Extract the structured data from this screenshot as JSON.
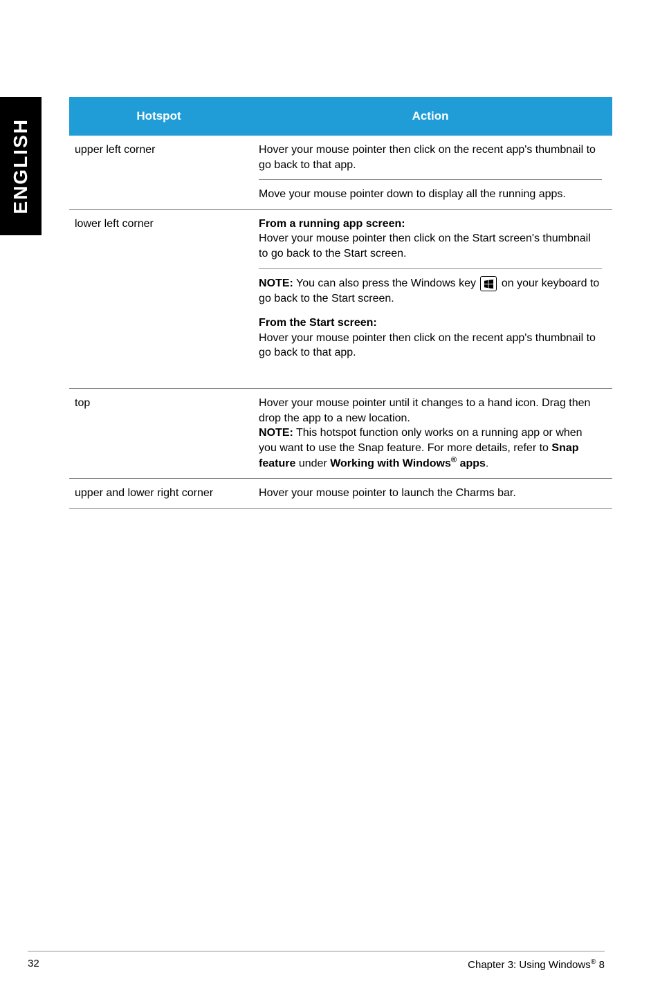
{
  "side_label": "ENGLISH",
  "table": {
    "headers": {
      "hotspot": "Hotspot",
      "action": "Action"
    },
    "rows": {
      "upper_left": {
        "label": "upper left corner",
        "action1": "Hover your mouse pointer then click on the recent app's thumbnail to go back to that app.",
        "action2": "Move your mouse pointer down to display all the running apps."
      },
      "lower_left": {
        "label": "lower left corner",
        "heading1": "From a running app screen:",
        "text1": "Hover your mouse pointer then click on the Start screen's thumbnail to go back to the Start screen.",
        "note_label": "NOTE:",
        "note_pre": "  You can also press the Windows key ",
        "note_post": " on your keyboard to go back to the Start screen.",
        "heading2": "From the Start screen:",
        "text2": "Hover your mouse pointer then click on the recent app's thumbnail to go back to that app."
      },
      "top": {
        "label": "top",
        "text1": "Hover your mouse pointer until it changes to a hand icon. Drag then drop the app to a new location.",
        "note_label": "NOTE:",
        "note_text": "  This hotspot function only works on a running app or when you want to use the Snap feature. For more details, refer to ",
        "bold1": "Snap feature",
        "mid": " under ",
        "bold2": "Working with Windows",
        "sup": "®",
        "bold3": " apps",
        "end": "."
      },
      "upper_lower_right": {
        "label": "upper and lower right corner",
        "action": "Hover your mouse pointer to launch the Charms bar."
      }
    }
  },
  "footer": {
    "page": "32",
    "chapter": "Chapter 3: Using Windows",
    "sup": "®",
    "suffix": " 8"
  }
}
